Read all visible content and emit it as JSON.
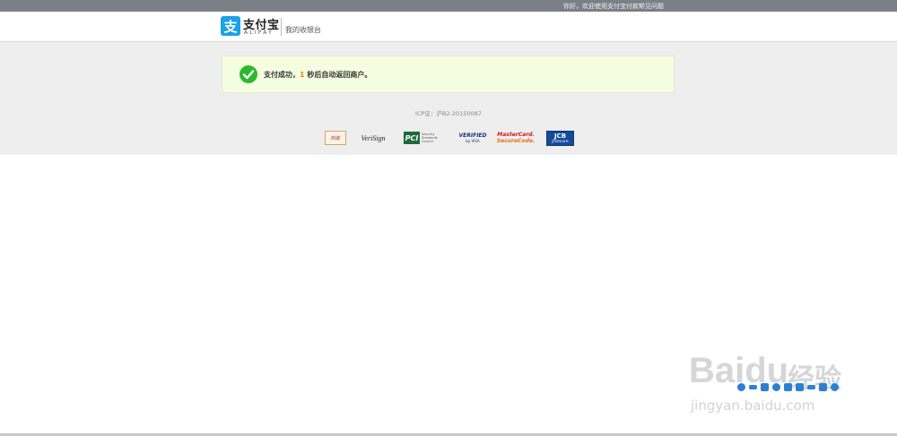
{
  "topbar": {
    "welcome": "你好，欢迎使用支付宝付款!",
    "faq": "常见问题"
  },
  "header": {
    "logo_cn": "支付宝",
    "logo_en": "ALIPAY",
    "cashier": "我的收银台"
  },
  "result": {
    "prefix": "支付成功，",
    "seconds": "1",
    "suffix": " 秒后自动返回商户。"
  },
  "footer": {
    "icp": "ICP证：沪B2-20150087"
  },
  "trust_badges": {
    "mall_seal": "商城",
    "verisign": "VeriSign",
    "pci": "PCI",
    "pci_text": "Security Standards Council",
    "visa_1": "VERIFIED",
    "visa_2": "by VISA",
    "mastercard_1": "MasterCard.",
    "mastercard_2": "SecureCode.",
    "jcb_1": "JCB",
    "jcb_2": "J/Secure"
  },
  "watermark": {
    "brand": "Bai",
    "brand2": "du",
    "exp": "经验",
    "url": "jingyan.baidu.com"
  },
  "colors": {
    "brand": "#1aa1e6",
    "success": "#2eb82e",
    "countdown": "#f08200",
    "topbar": "#7b7f86"
  },
  "icons": [
    "check-circle-icon",
    "alipay-logo-icon"
  ]
}
